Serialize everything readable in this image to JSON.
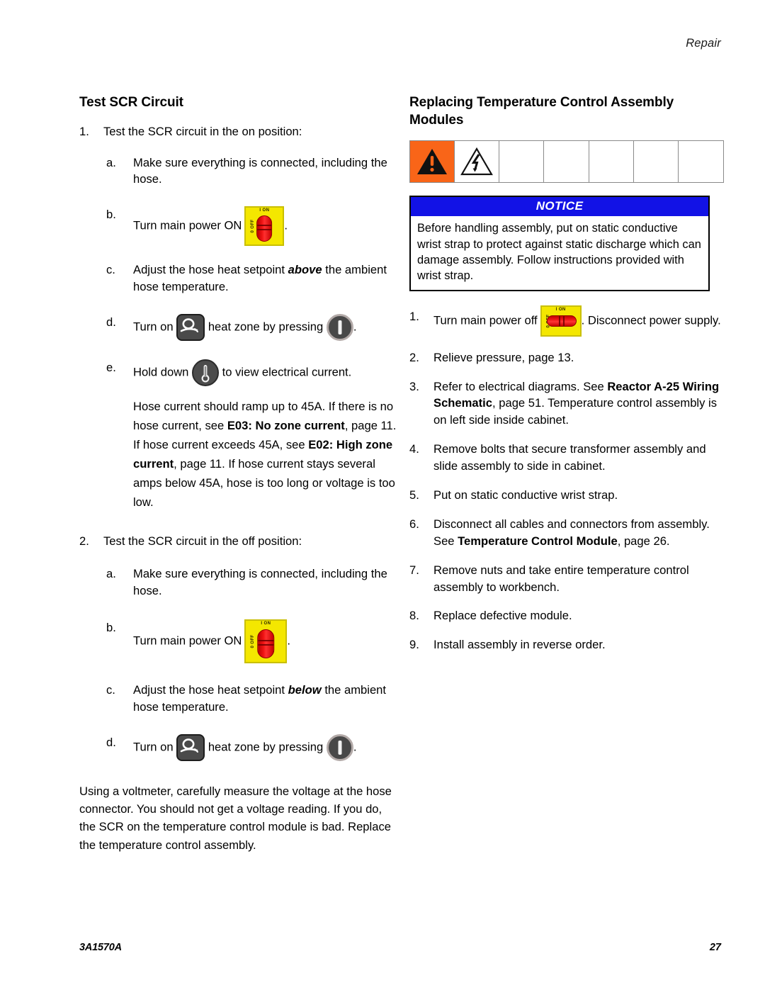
{
  "header": {
    "running_head": "Repair"
  },
  "footer": {
    "doc_number": "3A1570A",
    "page_number": "27"
  },
  "colors": {
    "hazard_orange": "#f96518",
    "notice_blue": "#1212e6",
    "switch_yellow": "#f4e700",
    "switch_red": "#ee1111"
  },
  "left_column": {
    "title": "Test SCR Circuit",
    "step1": {
      "mark": "1.",
      "text": "Test the SCR circuit in the on position:",
      "sub": [
        {
          "mark": "a.",
          "text": "Make sure everything is connected, including the hose."
        },
        {
          "mark": "b.",
          "text_before": "Turn main power ON",
          "icon": "power-switch-on-icon",
          "text_after": "."
        },
        {
          "mark": "c.",
          "text_before": "Adjust the hose heat setpoint",
          "emphasis": "above",
          "text_after": "the ambient hose temperature."
        },
        {
          "mark": "d.",
          "text_before": "Turn on",
          "icon1": "hose-heat-zone-icon",
          "text_mid": "heat zone by pressing",
          "icon2": "on-off-key-icon",
          "text_after": "."
        },
        {
          "mark": "e.",
          "text_before": "Hold down",
          "icon1": "thermometer-current-key-icon",
          "text_after": "to view electrical current."
        }
      ],
      "note_paragraph": {
        "p1": "Hose current should ramp up to 45A. If there is no hose current, see ",
        "b1": "E03: No zone current",
        "p2": ", page 11. If hose current exceeds 45A, see ",
        "b2": "E02: High zone current",
        "p3": ", page 11. If hose current stays several amps below 45A, hose is too long or voltage is too low."
      }
    },
    "step2": {
      "mark": "2.",
      "text": "Test the SCR circuit in the off position:",
      "sub": [
        {
          "mark": "a.",
          "text": "Make sure everything is connected, including the hose."
        },
        {
          "mark": "b.",
          "text_before": "Turn main power ON",
          "icon": "power-switch-on-icon",
          "text_after": "."
        },
        {
          "mark": "c.",
          "text_before": "Adjust the hose heat setpoint",
          "emphasis": "below",
          "text_after": "the ambient hose temperature."
        },
        {
          "mark": "d.",
          "text_before": "Turn on",
          "icon1": "hose-heat-zone-icon",
          "text_mid": "heat zone by pressing",
          "icon2": "on-off-key-icon",
          "text_after": "."
        }
      ]
    },
    "closing_paragraph": "Using a voltmeter, carefully measure the voltage at the hose connector. You should not get a voltage reading. If you do, the SCR on the temperature control module is bad. Replace the temperature control assembly."
  },
  "right_column": {
    "title": "Replacing Temperature Control Assembly Modules",
    "hazard_icons": [
      {
        "name": "general-warning-triangle-icon",
        "background": "#f96518"
      },
      {
        "name": "electric-shock-hazard-icon",
        "background": "#ffffff"
      },
      {
        "name": "empty-cell",
        "background": "#ffffff"
      },
      {
        "name": "empty-cell",
        "background": "#ffffff"
      },
      {
        "name": "empty-cell",
        "background": "#ffffff"
      },
      {
        "name": "empty-cell",
        "background": "#ffffff"
      },
      {
        "name": "empty-cell",
        "background": "#ffffff"
      }
    ],
    "notice": {
      "heading": "NOTICE",
      "body": "Before handling assembly, put on static conductive wrist strap to protect against static discharge which can damage assembly. Follow instructions provided with wrist strap."
    },
    "steps": [
      {
        "mark": "1.",
        "text_before": "Turn main power off",
        "icon": "power-switch-off-icon",
        "text_after": ". Disconnect power supply."
      },
      {
        "mark": "2.",
        "text": "Relieve pressure, page 13."
      },
      {
        "mark": "3.",
        "p1": "Refer to electrical diagrams. See ",
        "b1": "Reactor A-25 Wiring Schematic",
        "p2": ", page 51. Temperature control assembly is on left side inside cabinet."
      },
      {
        "mark": "4.",
        "text": "Remove bolts that secure transformer assembly and slide assembly to side in cabinet."
      },
      {
        "mark": "5.",
        "text": "Put on static conductive wrist strap."
      },
      {
        "mark": "6.",
        "p1": "Disconnect all cables and connectors from assembly. See ",
        "b1": "Temperature Control Module",
        "p2": ", page 26."
      },
      {
        "mark": "7.",
        "text": "Remove nuts and take entire temperature control assembly to workbench."
      },
      {
        "mark": "8.",
        "text": "Replace defective module."
      },
      {
        "mark": "9.",
        "text": "Install assembly in reverse order."
      }
    ]
  },
  "switch_labels": {
    "on": "I ON",
    "off": "0 OFF"
  }
}
